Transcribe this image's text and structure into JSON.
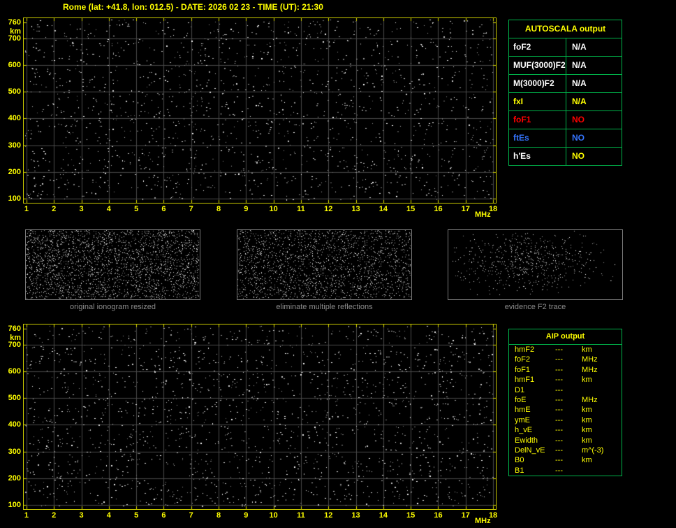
{
  "header": {
    "title": "Rome (lat: +41.8, lon: 012.5) - DATE: 2026 02 23 - TIME (UT): 21:30"
  },
  "colors": {
    "accent_yellow": "#ffff00",
    "plot_border": "#c8c800",
    "table_green": "#00b44a",
    "status_red": "#ff0000",
    "status_blue": "#3575ff",
    "text_white": "#ffffff",
    "panel_label_gray": "#8c8c8c"
  },
  "top_plot": {
    "y_unit": "km",
    "x_unit": "MHz",
    "y_ticks": [
      760,
      700,
      600,
      500,
      400,
      300,
      200,
      100
    ],
    "x_ticks": [
      1,
      2,
      3,
      4,
      5,
      6,
      7,
      8,
      9,
      10,
      11,
      12,
      13,
      14,
      15,
      16,
      17,
      18
    ]
  },
  "bottom_plot": {
    "y_unit": "km",
    "x_unit": "MHz",
    "y_ticks": [
      760,
      700,
      600,
      500,
      400,
      300,
      200,
      100
    ],
    "x_ticks": [
      1,
      2,
      3,
      4,
      5,
      6,
      7,
      8,
      9,
      10,
      11,
      12,
      13,
      14,
      15,
      16,
      17,
      18
    ]
  },
  "autoscala_table": {
    "title": "AUTOSCALA output",
    "rows": [
      {
        "label": "foF2",
        "value": "N/A",
        "label_color": "#ffffff",
        "value_color": "#ffffff"
      },
      {
        "label": "MUF(3000)F2",
        "value": "N/A",
        "label_color": "#ffffff",
        "value_color": "#ffffff"
      },
      {
        "label": "M(3000)F2",
        "value": "N/A",
        "label_color": "#ffffff",
        "value_color": "#ffffff"
      },
      {
        "label": "fxI",
        "value": "N/A",
        "label_color": "#ffff00",
        "value_color": "#ffff00"
      },
      {
        "label": "foF1",
        "value": "NO",
        "label_color": "#ff0000",
        "value_color": "#ff0000"
      },
      {
        "label": "ftEs",
        "value": "NO",
        "label_color": "#3575ff",
        "value_color": "#3575ff"
      },
      {
        "label": "h'Es",
        "value": "NO",
        "label_color": "#ffffff",
        "value_color": "#ffff00"
      }
    ]
  },
  "panels": [
    {
      "label": "original ionogram resized"
    },
    {
      "label": "eliminate multiple reflections"
    },
    {
      "label": "evidence F2 trace"
    }
  ],
  "aip_table": {
    "title": "AIP output",
    "rows": [
      {
        "label": "hmF2",
        "value": "---",
        "unit": "km"
      },
      {
        "label": "foF2",
        "value": "---",
        "unit": "MHz"
      },
      {
        "label": "foF1",
        "value": "---",
        "unit": "MHz"
      },
      {
        "label": "hmF1",
        "value": "---",
        "unit": "km"
      },
      {
        "label": "D1",
        "value": "---",
        "unit": ""
      },
      {
        "label": "foE",
        "value": "---",
        "unit": "MHz"
      },
      {
        "label": "hmE",
        "value": "---",
        "unit": "km"
      },
      {
        "label": "ymE",
        "value": "---",
        "unit": "km"
      },
      {
        "label": "h_vE",
        "value": "---",
        "unit": "km"
      },
      {
        "label": "Ewidth",
        "value": "---",
        "unit": "km"
      },
      {
        "label": "DelN_vE",
        "value": "---",
        "unit": "m^(-3)"
      },
      {
        "label": "B0",
        "value": "---",
        "unit": "km"
      },
      {
        "label": "B1",
        "value": "---",
        "unit": ""
      }
    ]
  }
}
